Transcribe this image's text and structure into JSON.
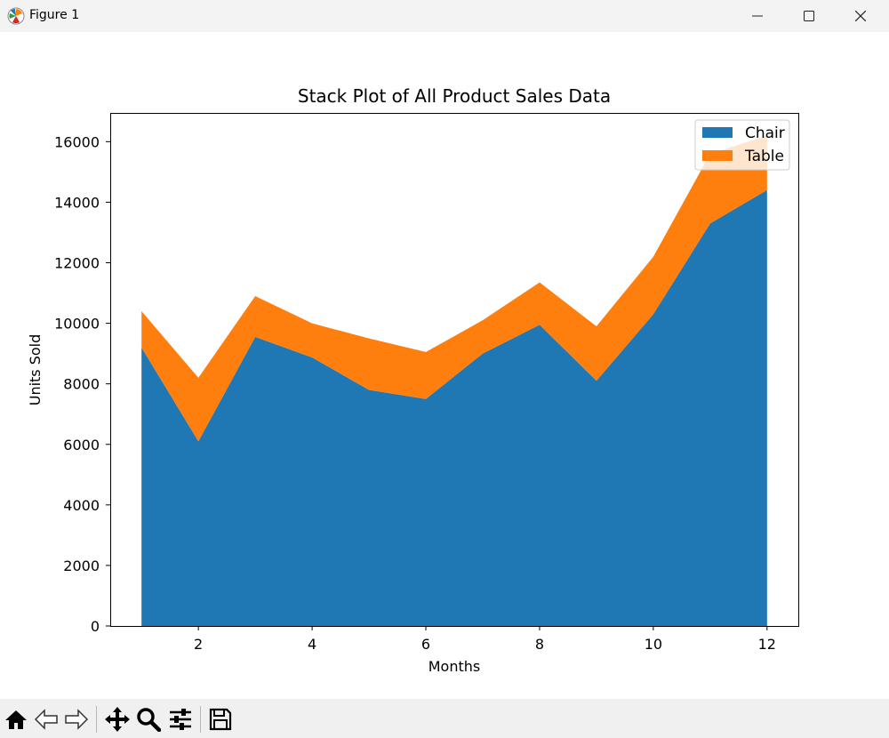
{
  "window": {
    "title": "Figure 1",
    "controls": [
      "minimize",
      "maximize",
      "close"
    ]
  },
  "toolbar": {
    "buttons": [
      {
        "icon": "home-icon"
      },
      {
        "icon": "back-icon"
      },
      {
        "icon": "forward-icon"
      },
      {
        "icon": "pan-icon"
      },
      {
        "icon": "zoom-icon"
      },
      {
        "icon": "configure-subplots-icon"
      },
      {
        "icon": "save-icon"
      }
    ]
  },
  "chart_data": {
    "type": "area",
    "stacked": true,
    "title": "Stack Plot of All Product Sales Data",
    "xlabel": "Months",
    "ylabel": "Units Sold",
    "x": [
      1,
      2,
      3,
      4,
      5,
      6,
      7,
      8,
      9,
      10,
      11,
      12
    ],
    "xlim": [
      0.45,
      12.55
    ],
    "ylim": [
      0,
      16950
    ],
    "xticks": [
      2,
      4,
      6,
      8,
      10,
      12
    ],
    "yticks": [
      0,
      2000,
      4000,
      6000,
      8000,
      10000,
      12000,
      14000,
      16000
    ],
    "legend_position": "top-right",
    "grid": false,
    "series": [
      {
        "name": "Chair",
        "color": "#1f77b4",
        "values": [
          9200,
          6100,
          9550,
          8870,
          7800,
          7500,
          9000,
          9950,
          8100,
          10300,
          13300,
          14400
        ]
      },
      {
        "name": "Table",
        "color": "#ff7f0e",
        "values": [
          1200,
          2100,
          1350,
          1130,
          1700,
          1550,
          1100,
          1400,
          1800,
          1900,
          2300,
          1800
        ]
      }
    ]
  }
}
